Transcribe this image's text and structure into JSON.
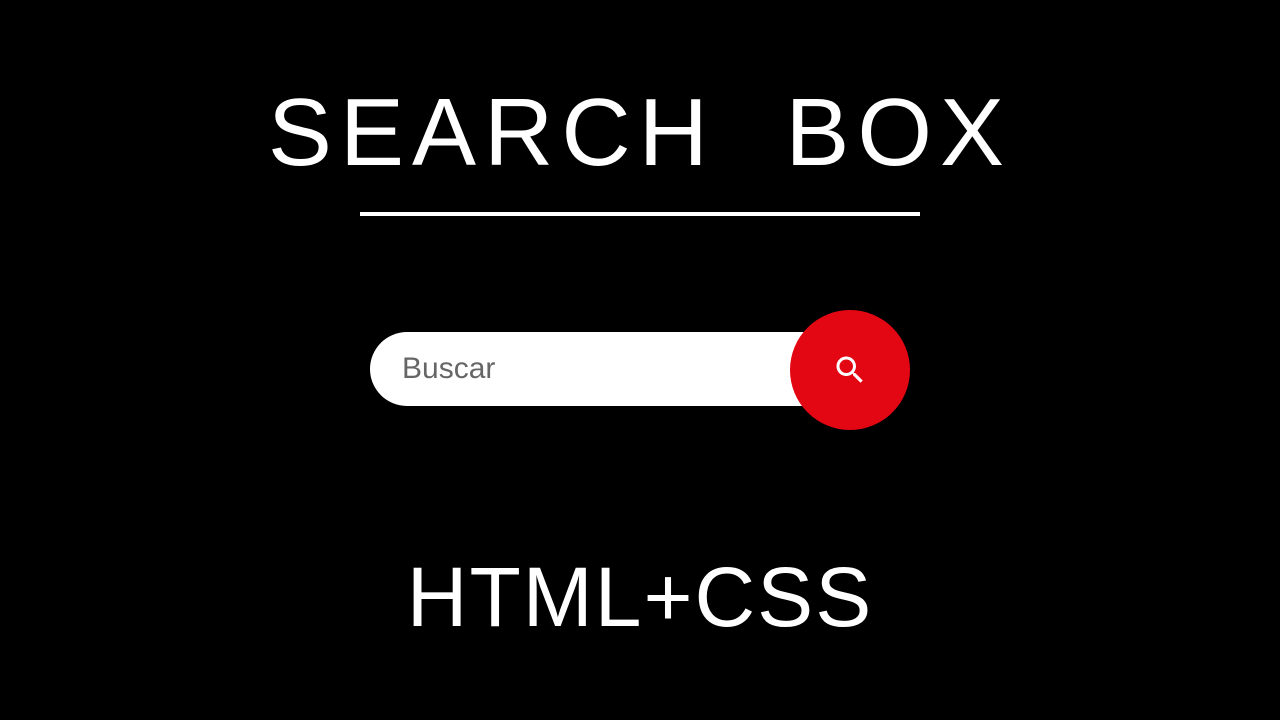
{
  "heading": {
    "title": "SEARCH  BOX"
  },
  "search": {
    "placeholder": "Buscar",
    "value": ""
  },
  "footer": {
    "subtitle": "HTML+CSS"
  },
  "colors": {
    "background": "#000000",
    "text": "#ffffff",
    "accent": "#e30613",
    "placeholder": "#666666"
  }
}
